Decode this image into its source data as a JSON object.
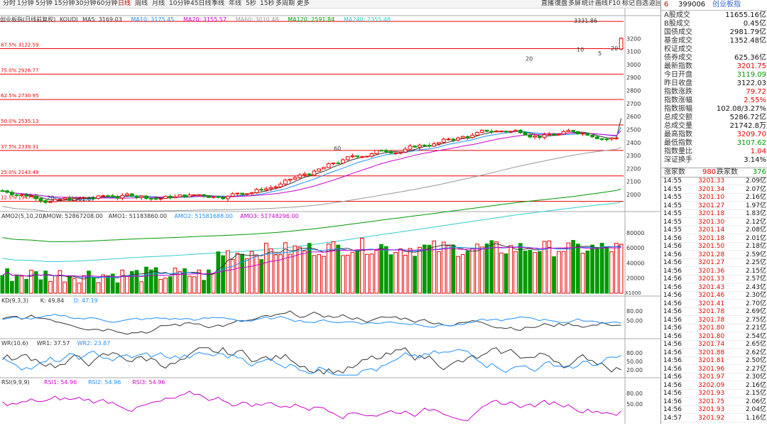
{
  "toolbar": {
    "left_items": [
      "分时",
      "1分钟",
      "5分钟",
      "15分钟",
      "30分钟",
      "60分钟",
      "日线",
      "周线",
      "月线",
      "10分钟",
      "45日线",
      "季线",
      "年线",
      "5秒",
      "15秒",
      "多周期",
      "更多"
    ],
    "active_item": "日线",
    "right_items": [
      "直播",
      "復盘",
      "多屏",
      "统计",
      "画线",
      "F10",
      "标记",
      "自选",
      "返回"
    ]
  },
  "main_chart": {
    "legend": {
      "title": "创业板指(日线前复权)",
      "ma": [
        {
          "label": "KOUDI",
          "color": "#333333"
        },
        {
          "label": "MA5: 3169.03",
          "color": "#333333"
        },
        {
          "label": "MA10: 3175.45",
          "color": "#1e90ff"
        },
        {
          "label": "MA20: 3155.57",
          "color": "#cc00cc"
        },
        {
          "label": "MA60: 3010.48",
          "color": "#999999"
        },
        {
          "label": "MA120: 2591.84",
          "color": "#009900"
        },
        {
          "label": "MA240: 2355.48",
          "color": "#33cccc"
        }
      ]
    },
    "y_axis": [
      "3200",
      "3100",
      "3000",
      "2900",
      "2800",
      "2700",
      "2600",
      "2500",
      "2400",
      "2300",
      "2200",
      "2100",
      "2000"
    ],
    "fib_labels": [
      "87.5% 3122.59",
      "75.0% 2926.77",
      "62.5% 2730.95",
      "50.0% 2535.13",
      "37.5% 2339.31",
      "25.0% 2143.49",
      "12.5% 1947.66"
    ],
    "annotations": {
      "high": "3331.86",
      "low": "1961.67",
      "marks": [
        "20",
        "5",
        "10",
        "20",
        "60",
        "20"
      ]
    }
  },
  "volume_chart": {
    "legend": {
      "title": "AMO2(5,10,20)",
      "items": [
        {
          "label": "AMOW: 52867208.00",
          "color": "#333333"
        },
        {
          "label": "AMO1: 51183860.00",
          "color": "#333333"
        },
        {
          "label": "AMO2: 51581688.00",
          "color": "#1e90ff"
        },
        {
          "label": "AMO3: 51748296.00",
          "color": "#cc00cc"
        }
      ]
    },
    "y_axis": [
      "80000",
      "60000",
      "40000",
      "20000"
    ],
    "unit": "X1000"
  },
  "kd_chart": {
    "legend": {
      "title": "KD(9,3,3)",
      "items": [
        {
          "label": "K: 49.84",
          "color": "#333333"
        },
        {
          "label": "D: 47.19",
          "color": "#1e90ff"
        }
      ]
    },
    "y_axis": [
      "80.00",
      "50.00"
    ]
  },
  "wr_chart": {
    "legend": {
      "title": "WR(10,6)",
      "items": [
        {
          "label": "WR1: 37.57",
          "color": "#333333"
        },
        {
          "label": "WR2: 23.87",
          "color": "#1e90ff"
        }
      ]
    },
    "y_axis": [
      "80.00",
      "50.00",
      "20.00"
    ]
  },
  "rsi_chart": {
    "legend": {
      "title": "RSI(9,9,9)",
      "items": [
        {
          "label": "RSI1: 54.96",
          "color": "#cc00cc"
        },
        {
          "label": "RSI2: 54.96",
          "color": "#1e90ff"
        },
        {
          "label": "RSI3: 54.96",
          "color": "#cc00cc"
        }
      ]
    },
    "y_axis": [
      "80.00",
      "50.00"
    ]
  },
  "right_panel": {
    "header_num": "6",
    "code": "399006",
    "name": "创业板指",
    "stats": [
      {
        "label": "A股成交",
        "value": "11655.16亿",
        "cls": "black"
      },
      {
        "label": "B股成交",
        "value": "0.45亿",
        "cls": "black"
      },
      {
        "label": "国债成交",
        "value": "2981.79亿",
        "cls": "black"
      },
      {
        "label": "基金成交",
        "value": "1352.48亿",
        "cls": "black"
      },
      {
        "label": "权证成交",
        "value": "",
        "cls": "black"
      },
      {
        "label": "债券成交",
        "value": "625.36亿",
        "cls": "black"
      },
      {
        "label": "最新指数",
        "value": "3201.75",
        "cls": "red"
      },
      {
        "label": "今日开盘",
        "value": "3119.09",
        "cls": "green"
      },
      {
        "label": "昨日收盘",
        "value": "3122.03",
        "cls": "black"
      },
      {
        "label": "指数涨跌",
        "value": "79.72",
        "cls": "red"
      },
      {
        "label": "指数涨幅",
        "value": "2.55%",
        "cls": "red"
      },
      {
        "label": "指数振幅",
        "value": "102.08/3.27%",
        "cls": "black"
      },
      {
        "label": "总成交额",
        "value": "5286.72亿",
        "cls": "black"
      },
      {
        "label": "总成交量",
        "value": "21742.8万",
        "cls": "black"
      },
      {
        "label": "最高指数",
        "value": "3209.70",
        "cls": "red"
      },
      {
        "label": "最低指数",
        "value": "3107.62",
        "cls": "green"
      },
      {
        "label": "指数量比",
        "value": "1.04",
        "cls": "red"
      },
      {
        "label": "深证换手",
        "value": "3.14%",
        "cls": "black"
      }
    ],
    "updown": {
      "up_label": "涨家数",
      "up": "980",
      "down_label": "跌家数",
      "down": "376"
    },
    "ticks": [
      [
        "14:55",
        "3201.33",
        "2.09亿"
      ],
      [
        "14:55",
        "3201.34",
        "2.07亿"
      ],
      [
        "14:55",
        "3201.10",
        "2.16亿"
      ],
      [
        "14:55",
        "3201.27",
        "1.97亿"
      ],
      [
        "14:55",
        "3201.18",
        "1.83亿"
      ],
      [
        "14:55",
        "3201.30",
        "2.12亿"
      ],
      [
        "14:55",
        "3201.14",
        "2.08亿"
      ],
      [
        "14:56",
        "3201.18",
        "2.01亿"
      ],
      [
        "14:56",
        "3201.50",
        "2.18亿"
      ],
      [
        "14:56",
        "3201.28",
        "2.59亿"
      ],
      [
        "14:56",
        "3201.27",
        "2.25亿"
      ],
      [
        "14:56",
        "3201.36",
        "2.15亿"
      ],
      [
        "14:56",
        "3201.33",
        "2.57亿"
      ],
      [
        "14:56",
        "3201.43",
        "2.43亿"
      ],
      [
        "14:56",
        "3201.46",
        "2.30亿"
      ],
      [
        "14:56",
        "3201.41",
        "2.70亿"
      ],
      [
        "14:56",
        "3201.78",
        "2.69亿"
      ],
      [
        "14:56",
        "3201.78",
        "2.75亿"
      ],
      [
        "14:56",
        "3201.80",
        "2.21亿"
      ],
      [
        "14:56",
        "3201.80",
        "2.54亿"
      ],
      [
        "14:56",
        "3201.74",
        "2.65亿"
      ],
      [
        "14:56",
        "3201.88",
        "2.62亿"
      ],
      [
        "14:56",
        "3201.81",
        "2.50亿"
      ],
      [
        "14:56",
        "3201.96",
        "2.27亿"
      ],
      [
        "14:56",
        "3201.97",
        "2.30亿"
      ],
      [
        "14:56",
        "3202.09",
        "2.16亿"
      ],
      [
        "14:56",
        "3201.93",
        "2.15亿"
      ],
      [
        "14:56",
        "3201.75",
        "2.06亿"
      ],
      [
        "14:56",
        "3201.93",
        "2.04亿"
      ],
      [
        "14:57",
        "3201.92",
        "1.16亿"
      ]
    ]
  }
}
